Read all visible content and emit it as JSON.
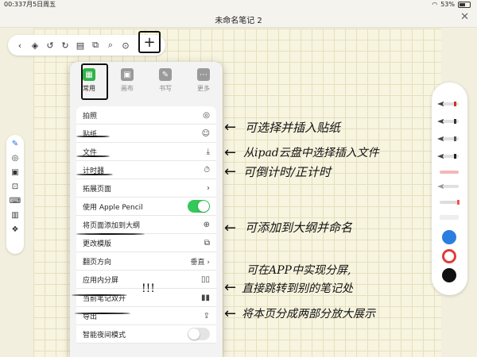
{
  "status": {
    "time": "00:33",
    "date": "7月5日周五",
    "battery": "53%"
  },
  "window": {
    "title": "未命名笔记 2",
    "close": "✕"
  },
  "toolbar": {
    "icons": [
      "chevron-left-icon",
      "layers-icon",
      "undo-icon",
      "redo-icon",
      "page-icon",
      "copy-icon",
      "search-icon",
      "mic-icon"
    ],
    "plus": "+"
  },
  "popup": {
    "tabs": [
      {
        "label": "常用",
        "glyph": "▦"
      },
      {
        "label": "画布",
        "glyph": "▣"
      },
      {
        "label": "书写",
        "glyph": "✎"
      },
      {
        "label": "更多",
        "glyph": "⋯"
      }
    ],
    "rows": [
      {
        "label": "拍照",
        "icon": "◎"
      },
      {
        "label": "贴纸",
        "icon": "☺"
      },
      {
        "label": "文件",
        "icon": "⤓"
      },
      {
        "label": "计时器",
        "icon": "⏱"
      },
      {
        "label": "拓展页面",
        "icon": "›"
      },
      {
        "label": "使用 Apple Pencil",
        "toggle": "on"
      },
      {
        "label": "将页面添加到大纲",
        "icon": "⊕"
      },
      {
        "label": "更改模版",
        "icon": "⧉"
      },
      {
        "label": "翻页方向",
        "value": "垂直 ›"
      },
      {
        "label": "应用内分屏",
        "icon": "▯▯"
      },
      {
        "label": "当前笔记双开",
        "icon": "▮▮"
      },
      {
        "label": "导出",
        "icon": "⇪"
      },
      {
        "label": "智能夜间模式",
        "toggle": "off"
      }
    ]
  },
  "annotations": {
    "sticker": "可选择并插入贴纸",
    "file": "从ipad云盘中选择插入文件",
    "timer": "可倒计时/正计时",
    "outline": "可添加到大纲并命名",
    "split1": "可在APP中实现分屏,",
    "split2": "直接跳转到别的笔记处",
    "dual": "将本页分成两部分放大展示",
    "exclaim": "!!!"
  },
  "colors": {
    "accent_green": "#34c759",
    "swatch_blue": "#2c7de0",
    "swatch_red": "#e23a3a",
    "swatch_black": "#111111"
  }
}
